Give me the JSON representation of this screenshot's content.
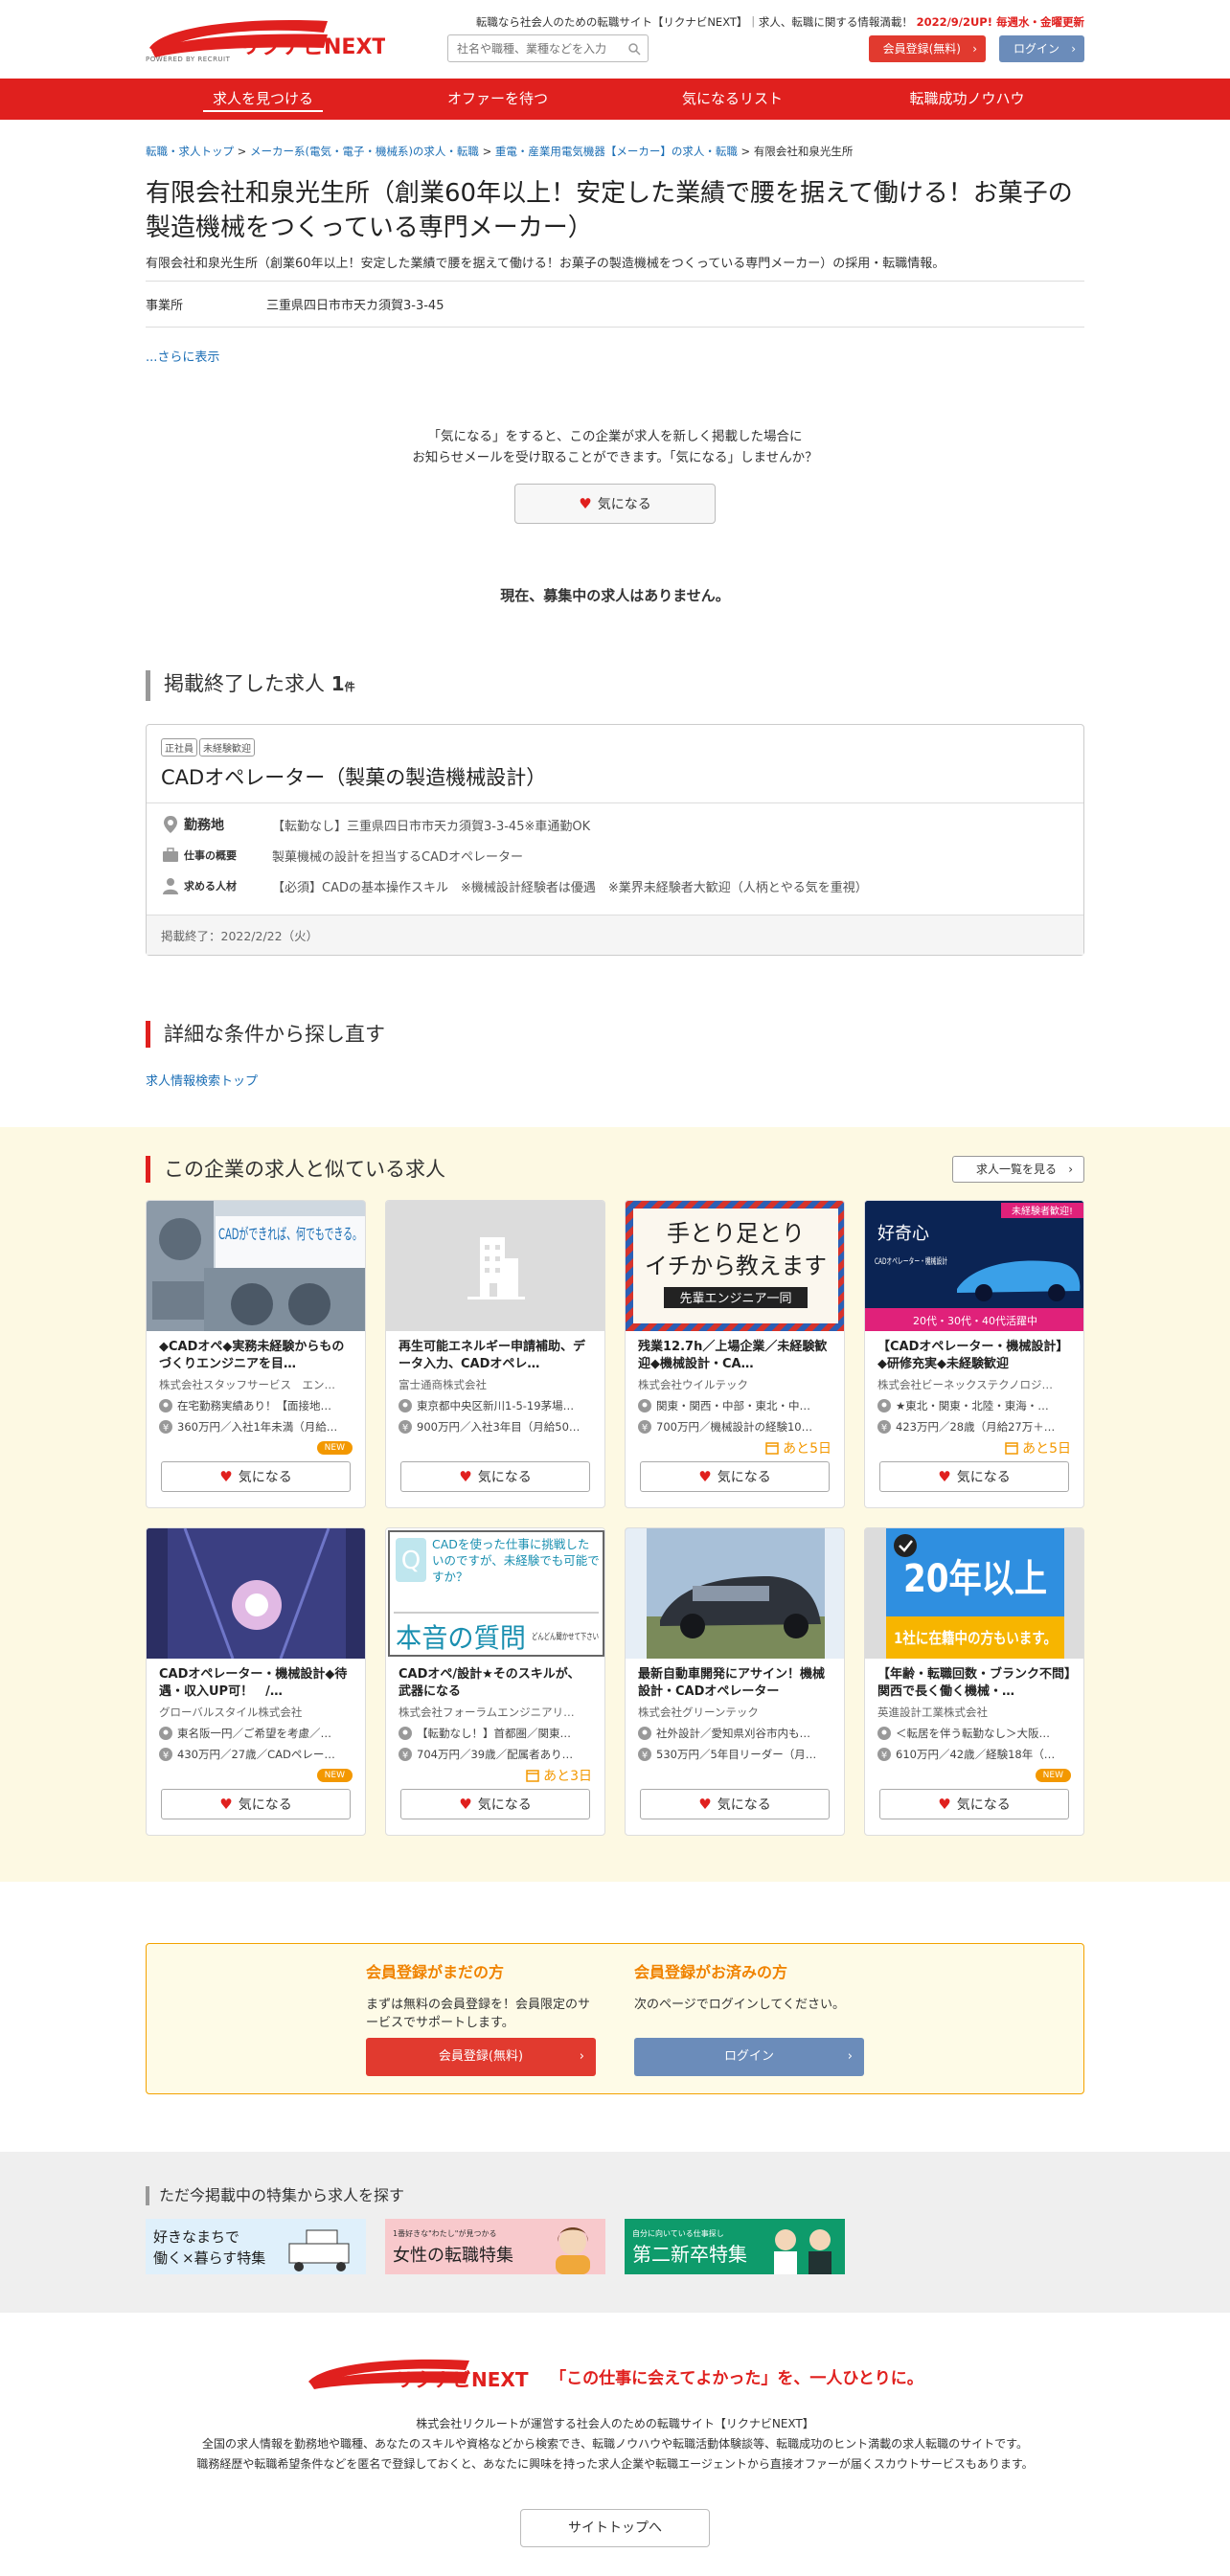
{
  "header": {
    "logo_text": "リクナビNEXT",
    "logo_sub": "POWERED BY RECRUIT",
    "tagline": "転職なら社会人のための転職サイト【リクナビNEXT】｜求人、転職に関する情報満載！",
    "tagline_update": "2022/9/2UP! 毎週水・金曜更新",
    "search_placeholder": "社名や職種、業種などを入力",
    "register_label": "会員登録(無料)",
    "login_label": "ログイン"
  },
  "nav": [
    {
      "label": "求人を見つける",
      "active": true
    },
    {
      "label": "オファーを待つ"
    },
    {
      "label": "気になるリスト"
    },
    {
      "label": "転職成功ノウハウ"
    }
  ],
  "breadcrumb": [
    "転職・求人トップ",
    "メーカー系(電気・電子・機械系)の求人・転職",
    "重電・産業用電気機器【メーカー】の求人・転職",
    "有限会社和泉光生所"
  ],
  "company": {
    "title": "有限会社和泉光生所（創業60年以上！安定した業績で腰を据えて働ける！お菓子の製造機械をつくっている専門メーカー）",
    "subtitle": "有限会社和泉光生所（創業60年以上！安定した業績で腰を据えて働ける！お菓子の製造機械をつくっている専門メーカー）の採用・転職情報。",
    "office_label": "事業所",
    "office_value": "三重県四日市市天カ須賀3-3-45",
    "more": "...さらに表示"
  },
  "favorite": {
    "line1": "「気になる」をすると、この企業が求人を新しく掲載した場合に",
    "line2": "お知らせメールを受け取ることができます。「気になる」しませんか？",
    "button": "気になる"
  },
  "no_jobs": "現在、募集中の求人はありません。",
  "ended": {
    "title": "掲載終了した求人",
    "count": "1",
    "unit": "件",
    "tags": [
      "正社員",
      "未経験歓迎"
    ],
    "job_title": "CADオペレーター（製菓の製造機械設計）",
    "location_label": "勤務地",
    "location_value": "【転勤なし】三重県四日市市天カ須賀3-3-45※車通勤OK",
    "work_label": "仕事の概要",
    "work_value": "製菓機械の設計を担当するCADオペレーター",
    "req_label": "求める人材",
    "req_value": "【必須】CADの基本操作スキル　※機械設計経験者は優遇　※業界未経験者大歓迎（人柄とやる気を重視）",
    "end_date": "掲載終了：2022/2/22（火）"
  },
  "detail": {
    "title": "詳細な条件から探し直す",
    "link": "求人情報検索トップ"
  },
  "similar": {
    "title": "この企業の求人と似ている求人",
    "list_button": "求人一覧を見る",
    "fav_label": "気になる",
    "cards": [
      {
        "title": "◆CADオペ◆実務未経験からものづくりエンジニアを目…",
        "company": "株式会社スタッフサービス　エン…",
        "loc": "在宅勤務実績あり！【面接地…",
        "salary": "360万円／入社1年未満（月給…",
        "meta": "NEW",
        "img_text": "CADができれば、何でもできる。"
      },
      {
        "title": "再生可能エネルギー申請補助、データ入力、CADオペレ…",
        "company": "富士通商株式会社",
        "loc": "東京都中央区新川1-5-19茅場…",
        "salary": "900万円／入社3年目（月給50…",
        "meta": ""
      },
      {
        "title": "残業12.7h／上場企業／未経験歓迎◆機械設計・CA…",
        "company": "株式会社ウイルテック",
        "loc": "関東・関西・中部・東北・中…",
        "salary": "700万円／機械設計の経験10…",
        "meta": "あと5日",
        "img_text1": "手とり足とり",
        "img_text2": "イチから教えます",
        "img_text3": "先輩エンジニア一同"
      },
      {
        "title": "【CADオペレーター・機械設計】◆研修充実◆未経験歓迎",
        "company": "株式会社ビーネックステクノロジ…",
        "loc": "★東北・関東・北陸・東海・…",
        "salary": "423万円／28歳（月給27万＋…",
        "meta": "あと5日",
        "img_badge": "未経験者歓迎!",
        "img_text1": "好奇心",
        "img_text2": "CADオペレーター・機械設計",
        "img_text3": "20代・30代・40代活躍中"
      },
      {
        "title": "CADオペレーター・機械設計◆待遇・収入UP可！　/…",
        "company": "グローバルスタイル株式会社",
        "loc": "東名阪一円／ご希望を考慮／…",
        "salary": "430万円／27歳／CADペレー…",
        "meta": "NEW"
      },
      {
        "title": "CADオペ/設計★そのスキルが、武器になる",
        "company": "株式会社フォーラムエンジニアリ…",
        "loc": "【転勤なし！】首都圏／関東…",
        "salary": "704万円／39歳／配属者あり…",
        "meta": "あと3日",
        "img_text1": "CADを使った仕事に挑戦したいのですが、未経験でも可能ですか？",
        "img_text2": "本音の質問",
        "img_text3": "どんどん聞かせて下さい"
      },
      {
        "title": "最新自動車開発にアサイン！機械設計・CADオペレーター",
        "company": "株式会社グリーンテック",
        "loc": "社外設計／愛知県刈谷市内も…",
        "salary": "530万円／5年目リーダー（月…",
        "meta": ""
      },
      {
        "title": "【年齢・転職回数・ブランク不問】関西で長く働く機械・…",
        "company": "英進設計工業株式会社",
        "loc": "＜転居を伴う転勤なし＞大阪…",
        "salary": "610万円／42歳／経験18年（…",
        "meta": "NEW",
        "img_text1": "20年以上",
        "img_text2": "1社に在籍中の方もいます。"
      }
    ]
  },
  "member": {
    "left_head": "会員登録がまだの方",
    "left_text": "まずは無料の会員登録を！会員限定のサービスでサポートします。",
    "left_button": "会員登録(無料)",
    "right_head": "会員登録がお済みの方",
    "right_text": "次のページでログインしてください。",
    "right_button": "ログイン"
  },
  "features": {
    "title": "ただ今掲載中の特集から求人を探す",
    "b1_line1": "好きなまちで",
    "b1_line2": "働く×暮らす特集",
    "b2_small": "1番好きな\"わたし\"が見つかる",
    "b2_main": "女性の転職特集",
    "b3_small": "自分に向いている仕事探し",
    "b3_main": "第二新卒特集"
  },
  "footer": {
    "logo_text": "リクナビNEXT",
    "catch": "「この仕事に会えてよかった」を、一人ひとりに。",
    "line1": "株式会社リクルートが運営する社会人のための転職サイト【リクナビNEXT】",
    "line2": "全国の求人情報を勤務地や職種、あなたのスキルや資格などから検索でき、転職ノウハウや転職活動体験談等、転職成功のヒント満載の求人転職のサイトです。",
    "line3": "職務経歴や転職希望条件などを匿名で登録しておくと、あなたに興味を持った求人企業や転職エージェントから直接オファーが届くスカウトサービスもあります。",
    "top_button": "サイトトップへ"
  },
  "colors": {
    "brand_red": "#e0201e",
    "orange": "#f39800",
    "login_blue": "#6b8cba"
  }
}
